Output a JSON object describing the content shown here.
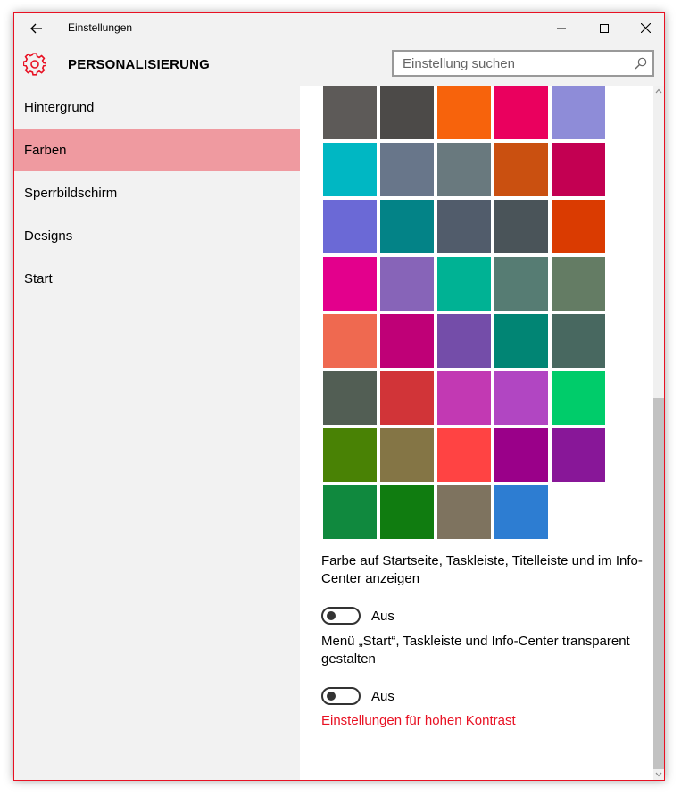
{
  "window": {
    "title": "Einstellungen",
    "border_color": "#e81123"
  },
  "titlebar": {
    "back_icon": "back-arrow-icon",
    "minimize_icon": "minimize-icon",
    "maximize_icon": "maximize-icon",
    "close_icon": "close-icon"
  },
  "header": {
    "icon": "gear-icon",
    "title": "PERSONALISIERUNG",
    "accent": "#e81123"
  },
  "search": {
    "placeholder": "Einstellung suchen",
    "value": "",
    "icon": "search-icon"
  },
  "sidebar": {
    "items": [
      {
        "label": "Hintergrund",
        "active": false
      },
      {
        "label": "Farben",
        "active": true
      },
      {
        "label": "Sperrbildschirm",
        "active": false
      },
      {
        "label": "Designs",
        "active": false
      },
      {
        "label": "Start",
        "active": false
      }
    ],
    "active_color": "#ef9aa0"
  },
  "colors": {
    "swatches": [
      "#5d5a58",
      "#4c4a48",
      "#f7630c",
      "#ea005e",
      "#8e8cd8",
      "#00b7c3",
      "#68768a",
      "#69797e",
      "#ca5010",
      "#c30052",
      "#6b69d6",
      "#038387",
      "#515c6b",
      "#4a5459",
      "#da3b01",
      "#e3008c",
      "#8764b8",
      "#00b294",
      "#567c73",
      "#647c64",
      "#ef6950",
      "#bf0077",
      "#744da9",
      "#018574",
      "#486860",
      "#525e54",
      "#d13438",
      "#c239b3",
      "#b146c2",
      "#00cc6a",
      "#498205",
      "#847545",
      "#ff4343",
      "#9a0089",
      "#881798",
      "#10893e",
      "#107c10",
      "#7e735f",
      "#2d7dd2"
    ]
  },
  "options": {
    "show_color": {
      "text": "Farbe auf Startseite, Taskleiste, Titelleiste und im Info-Center anzeigen",
      "state_label": "Aus",
      "on": false
    },
    "transparent": {
      "text": "Menü „Start“, Taskleiste und Info-Center transparent gestalten",
      "state_label": "Aus",
      "on": false
    },
    "high_contrast_link": "Einstellungen für hohen Kontrast"
  }
}
